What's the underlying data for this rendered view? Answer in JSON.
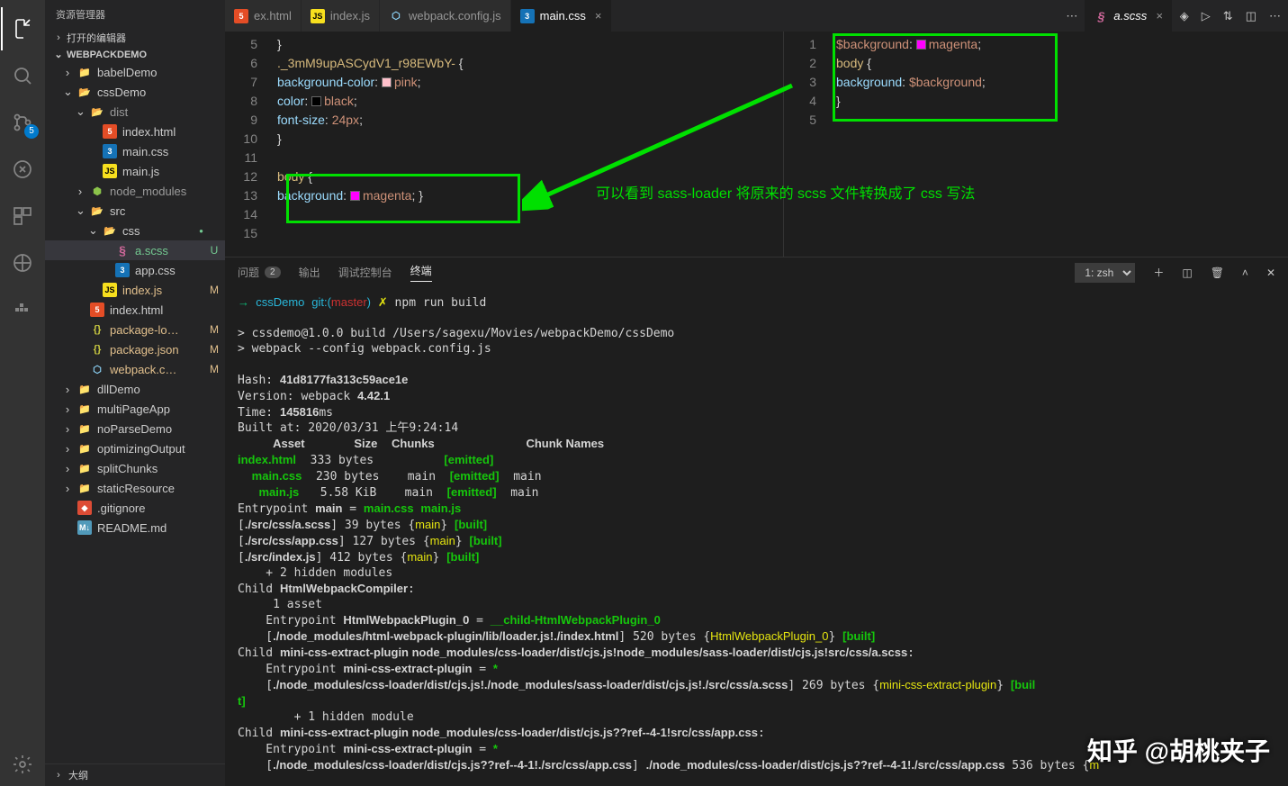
{
  "activityBadge": "5",
  "sidebar": {
    "title": "资源管理器",
    "openEditors": "打开的编辑器",
    "project": "WEBPACKDEMO",
    "outline": "大纲",
    "tree": [
      {
        "d": 1,
        "t": "folder",
        "n": "babelDemo"
      },
      {
        "d": 1,
        "t": "folder-open",
        "n": "cssDemo",
        "c": "g"
      },
      {
        "d": 2,
        "t": "folder-open",
        "n": "dist",
        "dim": true
      },
      {
        "d": 3,
        "t": "html",
        "n": "index.html"
      },
      {
        "d": 3,
        "t": "css",
        "n": "main.css"
      },
      {
        "d": 3,
        "t": "js",
        "n": "main.js"
      },
      {
        "d": 2,
        "t": "node",
        "n": "node_modules",
        "dim": true
      },
      {
        "d": 2,
        "t": "folder-open",
        "n": "src",
        "c": "g"
      },
      {
        "d": 3,
        "t": "folder-open",
        "n": "css",
        "c": "g",
        "dot": true
      },
      {
        "d": 4,
        "t": "scss",
        "n": "a.scss",
        "hl": true,
        "m": "U"
      },
      {
        "d": 4,
        "t": "css",
        "n": "app.css"
      },
      {
        "d": 3,
        "t": "js",
        "n": "index.js",
        "m": "M"
      },
      {
        "d": 2,
        "t": "html",
        "n": "index.html"
      },
      {
        "d": 2,
        "t": "json",
        "n": "package-lo…",
        "m": "M"
      },
      {
        "d": 2,
        "t": "json",
        "n": "package.json",
        "m": "M"
      },
      {
        "d": 2,
        "t": "webpack",
        "n": "webpack.c…",
        "m": "M"
      },
      {
        "d": 1,
        "t": "folder",
        "n": "dllDemo"
      },
      {
        "d": 1,
        "t": "folder",
        "n": "multiPageApp"
      },
      {
        "d": 1,
        "t": "folder",
        "n": "noParseDemo"
      },
      {
        "d": 1,
        "t": "folder",
        "n": "optimizingOutput"
      },
      {
        "d": 1,
        "t": "folder",
        "n": "splitChunks"
      },
      {
        "d": 1,
        "t": "folder",
        "n": "staticResource"
      },
      {
        "d": 1,
        "t": "git",
        "n": ".gitignore"
      },
      {
        "d": 1,
        "t": "md",
        "n": "README.md"
      }
    ]
  },
  "tabsLeft": [
    {
      "icon": "html",
      "label": "ex.html"
    },
    {
      "icon": "js",
      "label": "index.js"
    },
    {
      "icon": "webpack",
      "label": "webpack.config.js"
    },
    {
      "icon": "css",
      "label": "main.css",
      "active": true,
      "close": true
    }
  ],
  "tabsRight": [
    {
      "icon": "scss",
      "label": "a.scss",
      "active": true,
      "italic": true,
      "close": true
    }
  ],
  "editorLeft": {
    "gutter": [
      "5",
      "6",
      "7",
      "8",
      "9",
      "10",
      "11",
      "12",
      "13",
      "14",
      "15"
    ],
    "lines": [
      {
        "tok": [
          {
            "c": "cm-punct",
            "t": "}"
          }
        ]
      },
      {
        "tok": [
          {
            "c": "cm-sel",
            "t": "._3mM9upASCydV1_r98EWbY-"
          },
          {
            "c": "cm-punct",
            "t": " {"
          }
        ]
      },
      {
        "tok": [
          {
            "c": "",
            "t": "    "
          },
          {
            "c": "cm-prop",
            "t": "background-color"
          },
          {
            "c": "cm-punct",
            "t": ": "
          },
          {
            "col": "#ffc0cb"
          },
          {
            "c": "cm-val",
            "t": "pink"
          },
          {
            "c": "cm-punct",
            "t": ";"
          }
        ]
      },
      {
        "tok": [
          {
            "c": "",
            "t": "    "
          },
          {
            "c": "cm-prop",
            "t": "color"
          },
          {
            "c": "cm-punct",
            "t": ": "
          },
          {
            "col": "#000"
          },
          {
            "c": "cm-val",
            "t": "black"
          },
          {
            "c": "cm-punct",
            "t": ";"
          }
        ]
      },
      {
        "tok": [
          {
            "c": "",
            "t": "    "
          },
          {
            "c": "cm-prop",
            "t": "font-size"
          },
          {
            "c": "cm-punct",
            "t": ": "
          },
          {
            "c": "cm-val",
            "t": "24px"
          },
          {
            "c": "cm-punct",
            "t": ";"
          }
        ]
      },
      {
        "tok": [
          {
            "c": "cm-punct",
            "t": "}"
          }
        ]
      },
      {
        "tok": []
      },
      {
        "tok": [
          {
            "c": "cm-sel",
            "t": "body"
          },
          {
            "c": "cm-punct",
            "t": " {"
          }
        ]
      },
      {
        "tok": [
          {
            "c": "",
            "t": "  "
          },
          {
            "c": "cm-prop",
            "t": "background"
          },
          {
            "c": "cm-punct",
            "t": ": "
          },
          {
            "col": "#ff00ff"
          },
          {
            "c": "cm-val",
            "t": "magenta"
          },
          {
            "c": "cm-punct",
            "t": "; }"
          }
        ]
      },
      {
        "tok": []
      },
      {
        "tok": []
      }
    ]
  },
  "editorRight": {
    "gutter": [
      "1",
      "2",
      "3",
      "4",
      "5"
    ],
    "lines": [
      {
        "tok": [
          {
            "c": "cm-var",
            "t": "$background"
          },
          {
            "c": "cm-punct",
            "t": ": "
          },
          {
            "col": "#ff00ff"
          },
          {
            "c": "cm-val",
            "t": "magenta"
          },
          {
            "c": "cm-punct",
            "t": ";"
          }
        ]
      },
      {
        "tok": [
          {
            "c": "cm-sel",
            "t": "body"
          },
          {
            "c": "cm-punct",
            "t": " {"
          }
        ]
      },
      {
        "tok": [
          {
            "c": "",
            "t": "    "
          },
          {
            "c": "cm-prop",
            "t": "background"
          },
          {
            "c": "cm-punct",
            "t": ": "
          },
          {
            "c": "cm-var",
            "t": "$background"
          },
          {
            "c": "cm-punct",
            "t": ";"
          }
        ]
      },
      {
        "tok": [
          {
            "c": "cm-punct",
            "t": "}"
          }
        ]
      },
      {
        "tok": []
      }
    ]
  },
  "annotation": "可以看到 sass-loader 将原来的 scss 文件转换成了 css 写法",
  "panel": {
    "tabs": {
      "problems": "问题",
      "problemsCount": "2",
      "output": "输出",
      "debug": "调试控制台",
      "terminal": "终端"
    },
    "shell": "1: zsh",
    "terminalHtml": "<span class='t-green'>→  </span><span class='t-cyan'>cssDemo</span> <span class='t-cyan'>git:(</span><span class='t-red'>master</span><span class='t-cyan'>)</span> <span class='t-yellow'>✗</span> npm run build\n\n&gt; cssdemo@1.0.0 build /Users/sagexu/Movies/webpackDemo/cssDemo\n&gt; webpack --config webpack.config.js\n\nHash: <span class='t-bold'>41d8177fa313c59ace1e</span>\nVersion: webpack <span class='t-bold'>4.42.1</span>\nTime: <span class='t-bold'>145816</span>ms\nBuilt at: 2020/03/31 上午9:24:14\n     <span class='t-bold'>Asset</span>       <span class='t-bold'>Size</span>  <span class='t-bold'>Chunks</span>             <span class='t-bold'>Chunk Names</span>\n<span class='t-bgreen'>index.html</span>  333 bytes          <span class='t-bgreen'>[emitted]</span>\n  <span class='t-bgreen'>main.css</span>  230 bytes    main  <span class='t-bgreen'>[emitted]</span>  main\n   <span class='t-bgreen'>main.js</span>   5.58 KiB    main  <span class='t-bgreen'>[emitted]</span>  main\nEntrypoint <span class='t-bold'>main</span> = <span class='t-bgreen'>main.css</span> <span class='t-bgreen'>main.js</span>\n[<span class='t-bold'>./src/css/a.scss</span>] 39 bytes {<span class='t-yellow'>main</span>} <span class='t-bgreen'>[built]</span>\n[<span class='t-bold'>./src/css/app.css</span>] 127 bytes {<span class='t-yellow'>main</span>} <span class='t-bgreen'>[built]</span>\n[<span class='t-bold'>./src/index.js</span>] 412 bytes {<span class='t-yellow'>main</span>} <span class='t-bgreen'>[built]</span>\n    + 2 hidden modules\nChild <span class='t-bold'>HtmlWebpackCompiler</span>:\n     1 asset\n    Entrypoint <span class='t-bold'>HtmlWebpackPlugin_0</span> = <span class='t-bgreen'>__child-HtmlWebpackPlugin_0</span>\n    [<span class='t-bold'>./node_modules/html-webpack-plugin/lib/loader.js!./index.html</span>] 520 bytes {<span class='t-yellow'>HtmlWebpackPlugin_0</span>} <span class='t-bgreen'>[built]</span>\nChild <span class='t-bold'>mini-css-extract-plugin node_modules/css-loader/dist/cjs.js!node_modules/sass-loader/dist/cjs.js!src/css/a.scss</span>:\n    Entrypoint <span class='t-bold'>mini-css-extract-plugin</span> = <span class='t-bgreen'>*</span>\n    [<span class='t-bold'>./node_modules/css-loader/dist/cjs.js!./node_modules/sass-loader/dist/cjs.js!./src/css/a.scss</span>] 269 bytes {<span class='t-yellow'>mini-css-extract-plugin</span>} <span class='t-bgreen'>[buil</span>\n<span class='t-bgreen'>t]</span>\n        + 1 hidden module\nChild <span class='t-bold'>mini-css-extract-plugin node_modules/css-loader/dist/cjs.js??ref--4-1!src/css/app.css</span>:\n    Entrypoint <span class='t-bold'>mini-css-extract-plugin</span> = <span class='t-bgreen'>*</span>\n    [<span class='t-bold'>./node_modules/css-loader/dist/cjs.js??ref--4-1!./src/css/app.css</span>] <span class='t-bold'>./node_modules/css-loader/dist/cjs.js??ref--4-1!./src/css/app.css</span> 536 bytes {<span class='t-yellow'>m</span>"
  },
  "watermark": "知乎 @胡桃夹子"
}
